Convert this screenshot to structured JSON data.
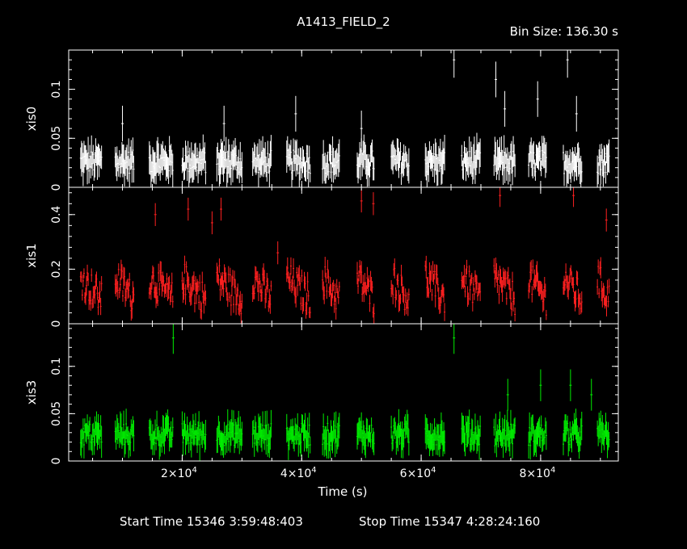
{
  "title": "A1413_FIELD_2",
  "bin_size_label": "Bin Size: 136.30 s",
  "xlabel": "Time (s)",
  "start_label": "Start Time 15346   3:59:48:403",
  "stop_label": "Stop Time 15347   4:28:24:160",
  "colors": {
    "background": "#000000",
    "frame": "#ffffff",
    "xis0": "#ffffff",
    "xis1": "#ff2020",
    "xis3": "#00ee00"
  },
  "chart_data": {
    "type": "scatter",
    "xlim": [
      1000,
      93000
    ],
    "x_ticks": [
      {
        "value": 20000,
        "label": "2×10",
        "exp": "4"
      },
      {
        "value": 40000,
        "label": "4×10",
        "exp": "4"
      },
      {
        "value": 60000,
        "label": "6×10",
        "exp": "4"
      },
      {
        "value": 80000,
        "label": "8×10",
        "exp": "4"
      }
    ],
    "orbit_segments": [
      [
        3000,
        6500
      ],
      [
        8800,
        12000
      ],
      [
        14500,
        18500
      ],
      [
        20000,
        24000
      ],
      [
        25800,
        30000
      ],
      [
        31800,
        35000
      ],
      [
        37500,
        41500
      ],
      [
        43500,
        46300
      ],
      [
        49300,
        52200
      ],
      [
        55000,
        58000
      ],
      [
        60700,
        64000
      ],
      [
        66800,
        70000
      ],
      [
        72200,
        75800
      ],
      [
        78000,
        81000
      ],
      [
        83800,
        87000
      ],
      [
        89500,
        91500
      ]
    ],
    "panels": [
      {
        "name": "xis0",
        "ylabel": "xis0",
        "ylim": [
          0,
          0.14
        ],
        "yticks": [
          0,
          0.05,
          0.1
        ],
        "ytick_labels": [
          "0",
          "0.05",
          "0.1"
        ],
        "base": 0.026,
        "noise": 0.012,
        "err": 0.013,
        "spikes": [
          [
            10000,
            0.065
          ],
          [
            27000,
            0.065
          ],
          [
            39000,
            0.075
          ],
          [
            50000,
            0.06
          ],
          [
            65500,
            0.13
          ],
          [
            72500,
            0.11
          ],
          [
            74000,
            0.08
          ],
          [
            79500,
            0.09
          ],
          [
            84500,
            0.13
          ],
          [
            86000,
            0.075
          ]
        ]
      },
      {
        "name": "xis1",
        "ylabel": "xis1",
        "ylim": [
          0,
          0.5
        ],
        "yticks": [
          0,
          0.2,
          0.4
        ],
        "ytick_labels": [
          "0",
          "0.2",
          "0.4"
        ],
        "base": 0.13,
        "noise": 0.06,
        "err": 0.03,
        "spikes": [
          [
            15500,
            0.4
          ],
          [
            21000,
            0.42
          ],
          [
            25000,
            0.37
          ],
          [
            26500,
            0.42
          ],
          [
            36000,
            0.26
          ],
          [
            50000,
            0.45
          ],
          [
            52000,
            0.44
          ],
          [
            73200,
            0.47
          ],
          [
            85500,
            0.47
          ],
          [
            91000,
            0.38
          ]
        ]
      },
      {
        "name": "xis3",
        "ylabel": "xis3",
        "ylim": [
          0,
          0.145
        ],
        "yticks": [
          0,
          0.05,
          0.1
        ],
        "ytick_labels": [
          "0",
          "0.05",
          "0.1"
        ],
        "base": 0.028,
        "noise": 0.012,
        "err": 0.012,
        "spikes": [
          [
            18500,
            0.13
          ],
          [
            65500,
            0.13
          ],
          [
            74500,
            0.07
          ],
          [
            80000,
            0.08
          ],
          [
            85000,
            0.08
          ],
          [
            88500,
            0.07
          ]
        ]
      }
    ]
  }
}
